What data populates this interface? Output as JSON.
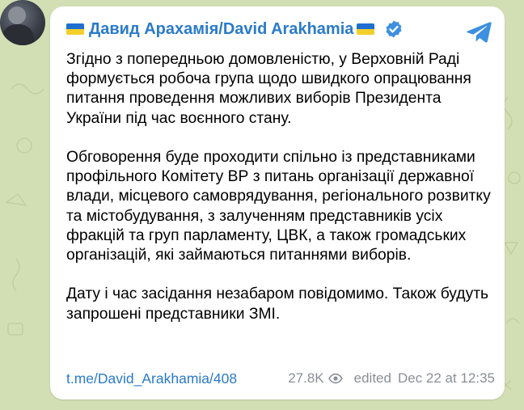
{
  "post": {
    "author": "Давид Арахамія/David Arakhamia",
    "paragraphs": [
      "Згідно з попередньою домовленістю, у Верховній Раді формується робоча група щодо швидкого опрацювання питання проведення можливих виборів Президента України під час воєнного стану.",
      "Обговорення буде проходити спільно із представниками профільного Комітету ВР з питань організації державної влади, місцевого самоврядування, регіонального розвитку та містобудування, з залученням представників усіх фракцій та груп парламенту, ЦВК, а також громадських організацій, які займаються питаннями виборів.",
      "Дату і час засідання незабаром повідомимо. Також будуть запрошені представники ЗМІ."
    ],
    "link": "t.me/David_Arakhamia/408",
    "views": "27.8K",
    "edited_label": "edited",
    "timestamp": "Dec 22 at 12:35"
  },
  "colors": {
    "background": "#d2dfb4",
    "accent_blue": "#2a7bc9",
    "meta_gray": "#8a8f96",
    "flag_blue": "#1f6fd1",
    "flag_yellow": "#f3cf2a"
  },
  "icons": [
    "avatar",
    "ukraine-flag-icon",
    "verified-badge-icon",
    "telegram-logo-icon",
    "eye-icon"
  ]
}
